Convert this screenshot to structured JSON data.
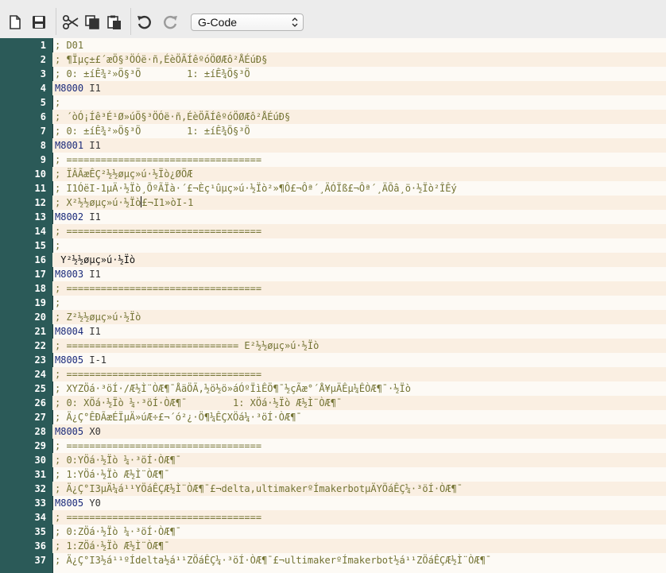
{
  "toolbar": {
    "buttons": [
      {
        "name": "new-file",
        "icon": "new-file-icon"
      },
      {
        "name": "save",
        "icon": "save-icon"
      },
      {
        "name": "cut",
        "icon": "scissors-icon"
      },
      {
        "name": "copy",
        "icon": "copy-icon"
      },
      {
        "name": "paste",
        "icon": "paste-icon"
      },
      {
        "name": "undo",
        "icon": "undo-icon"
      },
      {
        "name": "redo",
        "icon": "redo-icon"
      }
    ],
    "mode_select": {
      "value": "G-Code"
    }
  },
  "editor": {
    "lines": [
      {
        "n": "1",
        "text": "; D01",
        "kind": "comment"
      },
      {
        "n": "2",
        "text": "; ¶Ïµç±£´æÖ§³ÖÓë·ñ,ÉèÖÃÍêºóÖØÆô²ÅÉúÐ§",
        "kind": "comment"
      },
      {
        "n": "3",
        "text": "; 0: ±íÊ¾²»Ö§³Ö        1: ±íÊ¾Ö§³Ö",
        "kind": "comment"
      },
      {
        "n": "4",
        "cmd": "M8000",
        "args": " I1",
        "kind": "code"
      },
      {
        "n": "5",
        "text": ";",
        "kind": "comment"
      },
      {
        "n": "6",
        "text": "; ´òÓ¡Íê³É¹Ø»úÖ§³ÖÓë·ñ,ÉèÖÃÍêºóÖØÆô²ÅÉúÐ§",
        "kind": "comment"
      },
      {
        "n": "7",
        "text": "; 0: ±íÊ¾²»Ö§³Ö        1: ±íÊ¾Ö§³Ö",
        "kind": "comment"
      },
      {
        "n": "8",
        "cmd": "M8001",
        "args": " I1",
        "kind": "code"
      },
      {
        "n": "9",
        "text": "; ==================================",
        "kind": "comment"
      },
      {
        "n": "10",
        "text": "; ÏÂÃæÊÇ²½½øµç»ú·½Ïò¿ØÖÆ",
        "kind": "comment"
      },
      {
        "n": "11",
        "text": "; I1ÓëI-1µÄ·½Ïò¸ÕºÃÏà·´£¬Èç¹ûµç»ú·½Ïò²»¶Ô£¬Ôª´¸ÄÓÏß£¬Ôª´¸ÄÕâ¸ö·½Ïò²ÎÊý",
        "kind": "comment"
      },
      {
        "n": "12",
        "text": "; X²½½øµç»ú·½Ïò",
        "text_after": "£¬I1»òI-1",
        "kind": "comment",
        "caret": true
      },
      {
        "n": "13",
        "cmd": "M8002",
        "args": " I1",
        "kind": "code"
      },
      {
        "n": "14",
        "text": "; ==================================",
        "kind": "comment"
      },
      {
        "n": "15",
        "text": ";",
        "kind": "comment"
      },
      {
        "n": "16",
        "text": " Y²½½øµç»ú·½Ïò",
        "kind": "black"
      },
      {
        "n": "17",
        "cmd": "M8003",
        "args": " I1",
        "kind": "code"
      },
      {
        "n": "18",
        "text": "; ==================================",
        "kind": "comment"
      },
      {
        "n": "19",
        "text": ";",
        "kind": "comment"
      },
      {
        "n": "20",
        "text": "; Z²½½øµç»ú·½Ïò",
        "kind": "comment"
      },
      {
        "n": "21",
        "cmd": "M8004",
        "args": " I1",
        "kind": "code"
      },
      {
        "n": "22",
        "text": "; ============================== E²½½øµç»ú·½Ïò",
        "kind": "comment"
      },
      {
        "n": "23",
        "cmd": "M8005",
        "args": " I-1",
        "kind": "code"
      },
      {
        "n": "24",
        "text": "; ==================================",
        "kind": "comment"
      },
      {
        "n": "25",
        "text": "; XYZÖá·³öÍ·/Æ½Ì¨ÒÆ¶¯ÅäÖÃ,½ö½ö»áÓºÏìÊÖ¶¯½çÃæ°´Å¥µÄÊµ¼ÊÒÆ¶¯·½Ïò",
        "kind": "comment"
      },
      {
        "n": "26",
        "text": "; 0: XÖá·½Ïò ¼·³öÍ·ÒÆ¶¯        1: XÖá·½Ïò Æ½Ì¨ÒÆ¶¯",
        "kind": "comment"
      },
      {
        "n": "27",
        "text": "; Ä¿Ç°ÊÐÃæÉÏµÄ»úÆ÷£¬´ó²¿·Ö¶¼ÊÇXÖá¼·³öÍ·ÒÆ¶¯",
        "kind": "comment"
      },
      {
        "n": "28",
        "cmd": "M8005",
        "args": " X0",
        "kind": "code"
      },
      {
        "n": "29",
        "text": "; ==================================",
        "kind": "comment"
      },
      {
        "n": "30",
        "text": "; 0:YÖá·½Ïò ¼·³öÍ·ÒÆ¶¯",
        "kind": "comment"
      },
      {
        "n": "31",
        "text": "; 1:YÖá·½Ïò Æ½Ì¨ÒÆ¶¯",
        "kind": "comment"
      },
      {
        "n": "32",
        "text": "; Ä¿Ç°I3µÄ¼á¹¹YÖáÊÇÆ½Ì¨ÒÆ¶¯£¬delta,ultimakerºÍmakerbotµÄYÖáÊÇ¼·³öÍ·ÒÆ¶¯",
        "kind": "comment"
      },
      {
        "n": "33",
        "cmd": "M8005",
        "args": " Y0",
        "kind": "code"
      },
      {
        "n": "34",
        "text": "; ==================================",
        "kind": "comment"
      },
      {
        "n": "35",
        "text": "; 0:ZÖá·½Ïò ¼·³öÍ·ÒÆ¶¯",
        "kind": "comment"
      },
      {
        "n": "36",
        "text": "; 1:ZÖá·½Ïò Æ½Ì¨ÒÆ¶¯",
        "kind": "comment"
      },
      {
        "n": "37",
        "text": "; Ä¿Ç°I3½á¹¹ºÍdelta½á¹¹ZÖáÊÇ¼·³öÍ·ÒÆ¶¯£¬ultimakerºÍmakerbot½á¹¹ZÖáÊÇÆ½Ì¨ÒÆ¶¯",
        "kind": "comment"
      }
    ]
  }
}
